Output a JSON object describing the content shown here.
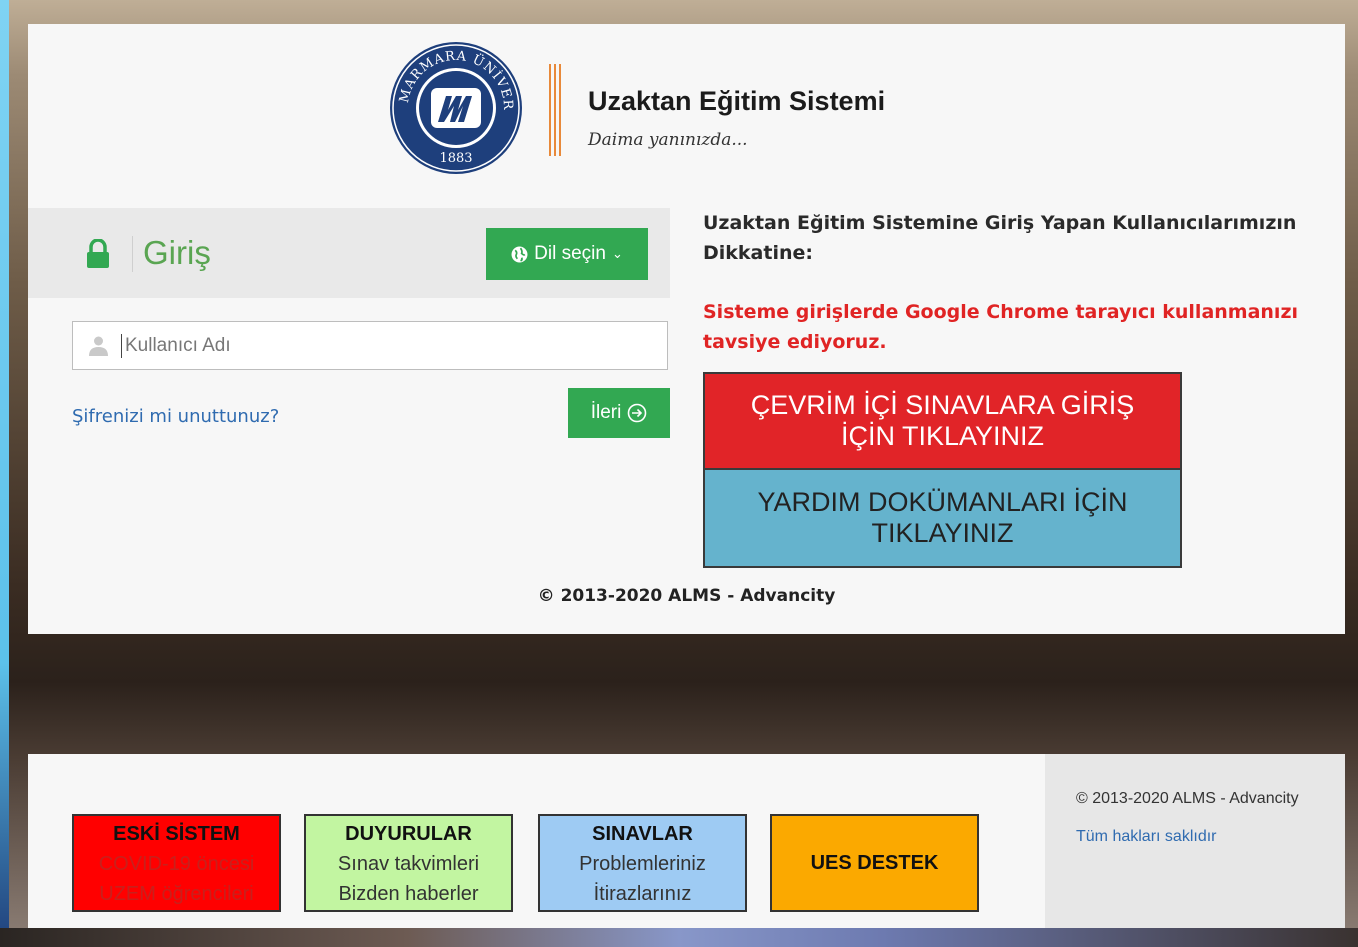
{
  "brand": {
    "seal_text": "MARMARA ÜNİVERSİTESİ",
    "seal_year": "1883",
    "title": "Uzaktan Eğitim Sistemi",
    "tagline": "Daima yanınızda..."
  },
  "login": {
    "title": "Giriş",
    "language_button": "Dil seçin",
    "username_placeholder": "Kullanıcı Adı",
    "forgot_link": "Şifrenizi mi unuttunuz?",
    "next_button": "İleri"
  },
  "notice": {
    "title": "Uzaktan Eğitim Sistemine Giriş Yapan Kullanıcılarımızın Dikkatine:",
    "warning": "Sisteme girişlerde Google Chrome tarayıcı kullanmanızı tavsiye ediyoruz."
  },
  "buttons": {
    "exams": "ÇEVRİM İÇİ SINAVLARA GİRİŞ\nİÇİN TIKLAYINIZ",
    "help": "YARDIM DOKÜMANLARI İÇİN\nTIKLAYINIZ"
  },
  "copyright": "© 2013-2020 ALMS - Advancity",
  "footer": {
    "boxes": [
      {
        "title": "ESKİ SİSTEM",
        "line1": "COVID-19 öncesi",
        "line2": "UZEM öğrencileri"
      },
      {
        "title": "DUYURULAR",
        "line1": "Sınav takvimleri",
        "line2": "Bizden haberler"
      },
      {
        "title": "SINAVLAR",
        "line1": "Problemleriniz",
        "line2": "İtirazlarınız"
      },
      {
        "title": "UES DESTEK"
      }
    ],
    "side_copyright": "© 2013-2020 ALMS - Advancity",
    "rights": "Tüm hakları saklıdır"
  },
  "colors": {
    "green": "#32a852",
    "red": "#e12428",
    "blue": "#65b3cd",
    "link": "#2f6bb0"
  },
  "icons": [
    "lock-icon",
    "globe-icon",
    "chevron-down-icon",
    "user-icon",
    "arrow-right-circle-icon",
    "university-seal-logo"
  ]
}
